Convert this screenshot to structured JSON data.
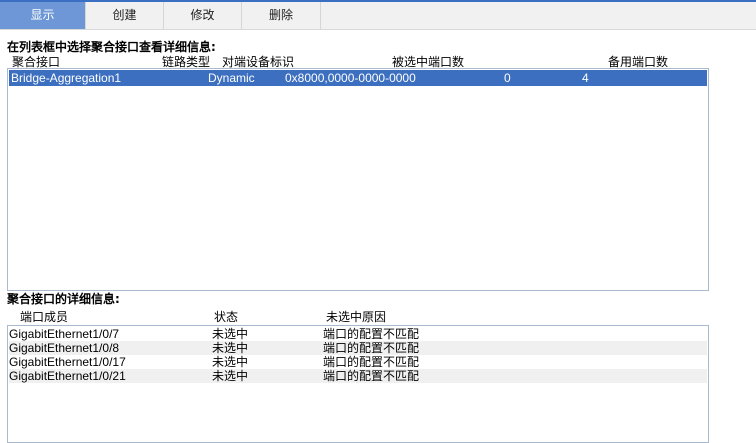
{
  "tabs": [
    "显示",
    "创建",
    "修改",
    "删除"
  ],
  "aggregation_section": {
    "title": "在列表框中选择聚合接口查看详细信息:",
    "columns": [
      "聚合接口",
      "链路类型",
      "对端设备标识",
      "被选中端口数",
      "备用端口数"
    ],
    "rows": [
      {
        "interface": "Bridge-Aggregation1",
        "link_type": "Dynamic",
        "peer_id": "0x8000,0000-0000-0000",
        "selected_ports": "0",
        "standby_ports": "4"
      }
    ]
  },
  "detail_section": {
    "title": "聚合接口的详细信息:",
    "columns": [
      "端口成员",
      "状态",
      "未选中原因"
    ],
    "rows": [
      {
        "member": "GigabitEthernet1/0/7",
        "status": "未选中",
        "reason": "端口的配置不匹配"
      },
      {
        "member": "GigabitEthernet1/0/8",
        "status": "未选中",
        "reason": "端口的配置不匹配"
      },
      {
        "member": "GigabitEthernet1/0/17",
        "status": "未选中",
        "reason": "端口的配置不匹配"
      },
      {
        "member": "GigabitEthernet1/0/21",
        "status": "未选中",
        "reason": "端口的配置不匹配"
      }
    ]
  },
  "colors": {
    "accent": "#3c6fbf",
    "active_tab": "#6d97d6",
    "border": "#a9b9d0"
  }
}
